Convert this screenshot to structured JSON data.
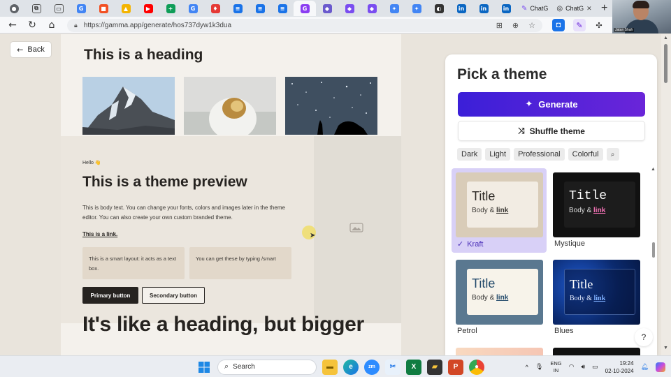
{
  "browser": {
    "tabs": [
      {
        "icon": "google-icon",
        "glyph": "G",
        "color": "#4285f4"
      },
      {
        "icon": "microsoft-icon",
        "glyph": "■",
        "color": "#f25022"
      },
      {
        "icon": "drive-icon",
        "glyph": "▲",
        "color": "#f4b400"
      },
      {
        "icon": "youtube-icon",
        "glyph": "▶",
        "color": "#ff0000"
      },
      {
        "icon": "sheets-icon",
        "glyph": "+",
        "color": "#0f9d58"
      },
      {
        "icon": "google-icon",
        "glyph": "G",
        "color": "#4285f4"
      },
      {
        "icon": "shield-icon",
        "glyph": "♦",
        "color": "#e53935"
      },
      {
        "icon": "docs-icon",
        "glyph": "≡",
        "color": "#1a73e8"
      },
      {
        "icon": "docs-icon",
        "glyph": "≡",
        "color": "#1a73e8"
      },
      {
        "icon": "docs-icon",
        "glyph": "≡",
        "color": "#1a73e8"
      },
      {
        "icon": "gamma-icon",
        "glyph": "G",
        "color": "#8b3df2"
      },
      {
        "icon": "app-icon",
        "glyph": "◆",
        "color": "#6a5acd"
      },
      {
        "icon": "app-icon",
        "glyph": "◆",
        "color": "#7a4df0"
      },
      {
        "icon": "app-icon",
        "glyph": "◆",
        "color": "#7a4df0"
      },
      {
        "icon": "gemini-icon",
        "glyph": "✦",
        "color": "#4285f4"
      },
      {
        "icon": "gemini-icon",
        "glyph": "✦",
        "color": "#4285f4"
      },
      {
        "icon": "clock-icon",
        "glyph": "◐",
        "color": "#333333"
      },
      {
        "icon": "linkedin-icon",
        "glyph": "in",
        "color": "#0a66c2"
      },
      {
        "icon": "linkedin-icon",
        "glyph": "in",
        "color": "#0a66c2"
      },
      {
        "icon": "linkedin-icon",
        "glyph": "in",
        "color": "#0a66c2"
      }
    ],
    "text_tabs": [
      {
        "label": "ChatG",
        "icon": "chatgpt-icon"
      },
      {
        "label": "ChatG",
        "icon": "chatgpt-icon"
      }
    ],
    "url": "https://gamma.app/generate/hos737dyw1k3dua"
  },
  "webcam": {
    "name": "Jatan Shah"
  },
  "page": {
    "back_label": "Back",
    "preview": {
      "heading": "This is a heading",
      "hello": "Hello 👋",
      "title": "This is a theme preview",
      "body": "This is body text. You can change your fonts, colors and images later in the theme editor. You can also create your own custom branded theme.",
      "link": "This is a link.",
      "smart_box_1": "This is a smart layout: it acts as a text box.",
      "smart_box_2": "You can get these by typing /smart",
      "primary_button": "Primary button",
      "secondary_button": "Secondary button",
      "big_heading": "It's like a heading, but bigger",
      "faded_text": "... and images later in the theme"
    },
    "panel": {
      "title": "Pick a theme",
      "generate_label": "Generate",
      "shuffle_label": "Shuffle theme",
      "filters": [
        "Dark",
        "Light",
        "Professional",
        "Colorful"
      ],
      "themes": [
        {
          "name": "Kraft",
          "title": "Title",
          "body": "Body &",
          "link": "link",
          "selected": true
        },
        {
          "name": "Mystique",
          "title": "Title",
          "body": "Body &",
          "link": "link",
          "selected": false
        },
        {
          "name": "Petrol",
          "title": "Title",
          "body": "Body &",
          "link": "link",
          "selected": false
        },
        {
          "name": "Blues",
          "title": "Title",
          "body": "Body &",
          "link": "link",
          "selected": false
        }
      ]
    },
    "help_label": "?"
  },
  "taskbar": {
    "search_placeholder": "Search",
    "language_top": "ENG",
    "language_bottom": "IN",
    "time": "19:24",
    "date": "02-10-2024"
  },
  "colors": {
    "accent_purple": "#5b21d9",
    "selected_tile": "#d8d0f7",
    "kraft_bg": "#d9ccb8"
  }
}
